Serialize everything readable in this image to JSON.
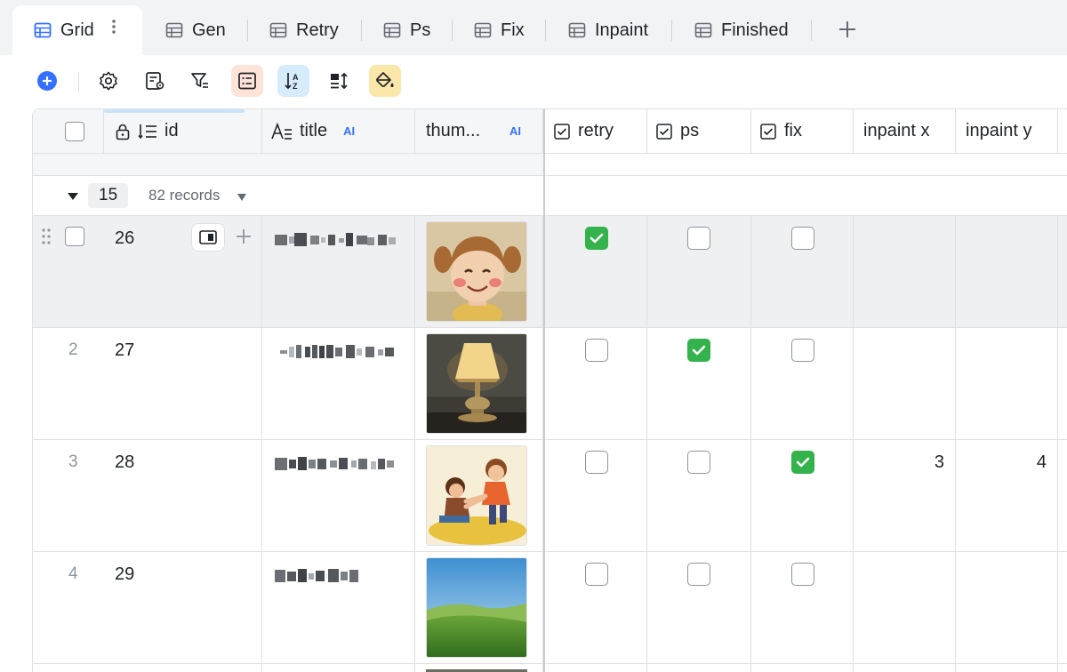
{
  "tabs": [
    {
      "label": "Grid",
      "active": true
    },
    {
      "label": "Gen"
    },
    {
      "label": "Retry"
    },
    {
      "label": "Ps"
    },
    {
      "label": "Fix"
    },
    {
      "label": "Inpaint"
    },
    {
      "label": "Finished"
    }
  ],
  "columns": {
    "id": "id",
    "title": "title",
    "thumb": "thum...",
    "retry": "retry",
    "ps": "ps",
    "fix": "fix",
    "inpaint_x": "inpaint x",
    "inpaint_y": "inpaint y",
    "ai_tag": "AI"
  },
  "group": {
    "value": "15",
    "count": "82 records"
  },
  "rows": [
    {
      "num": "",
      "id": "26",
      "retry": true,
      "ps": false,
      "fix": false,
      "inpaint_x": "",
      "inpaint_y": ""
    },
    {
      "num": "2",
      "id": "27",
      "retry": false,
      "ps": true,
      "fix": false,
      "inpaint_x": "",
      "inpaint_y": ""
    },
    {
      "num": "3",
      "id": "28",
      "retry": false,
      "ps": false,
      "fix": true,
      "inpaint_x": "3",
      "inpaint_y": "4"
    },
    {
      "num": "4",
      "id": "29",
      "retry": false,
      "ps": false,
      "fix": false,
      "inpaint_x": "",
      "inpaint_y": ""
    }
  ],
  "colors": {
    "accent": "#3370ff",
    "check_green": "#34b24b"
  }
}
